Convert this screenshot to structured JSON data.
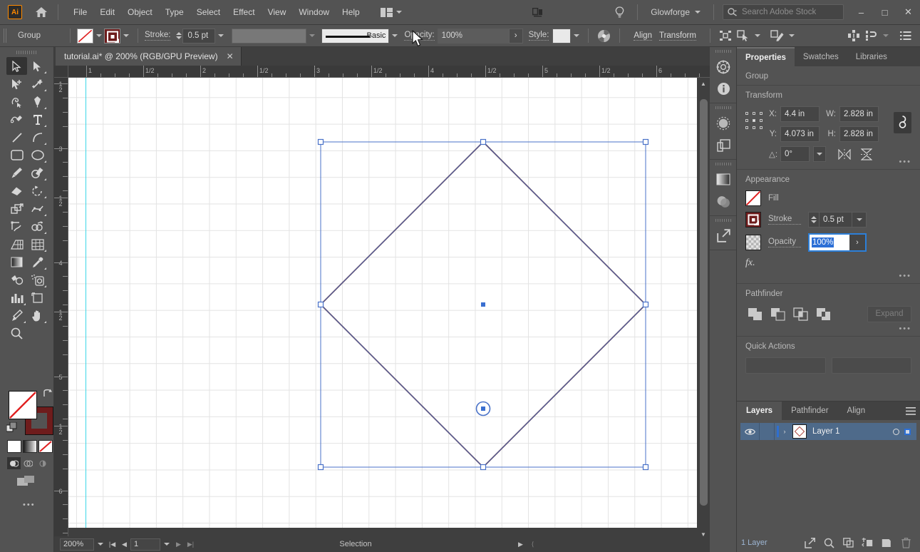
{
  "app": {
    "logo": "Ai",
    "home_icon": "home-icon",
    "arrange_icon": "arrange-documents-icon",
    "search_help_icon": "lightbulb-icon",
    "screen_share_icon": "share-screen-icon"
  },
  "menu": {
    "items": [
      "File",
      "Edit",
      "Object",
      "Type",
      "Select",
      "Effect",
      "View",
      "Window",
      "Help"
    ]
  },
  "account": {
    "workspace": "Glowforge",
    "chevron": "chevron-down-icon"
  },
  "search": {
    "placeholder": "Search Adobe Stock",
    "icon": "search-icon"
  },
  "window_controls": {
    "minimize": "–",
    "maximize": "□",
    "close": "✕"
  },
  "control_bar": {
    "selection_label": "Group",
    "fill_swatch": "none-swatch",
    "stroke_swatch": "stroke-swatch-maroon",
    "stroke_label": "Stroke:",
    "stroke_weight": "0.5 pt",
    "stroke_profile_placeholder": "",
    "brush_label": "Basic",
    "opacity_label": "Opacity:",
    "opacity_value": "100%",
    "style_label": "Style:",
    "recolor_icon": "recolor-artwork-icon",
    "align_label": "Align",
    "transform_label": "Transform",
    "shape_icon": "bounding-box-icon",
    "select_similar_icon": "select-similar-icon",
    "isolate_icon": "isolate-group-icon",
    "distribute_icon": "distribute-icon",
    "arrange_icon": "arrange-objects-icon",
    "options_icon": "panel-options-icon"
  },
  "document_tab": {
    "title": "tutorial.ai* @ 200% (RGB/GPU Preview)",
    "close": "✕"
  },
  "toolbar": {
    "tools": [
      {
        "name": "selection-tool",
        "glyph": "selection",
        "active": true
      },
      {
        "name": "direct-selection-tool",
        "glyph": "direct-selection",
        "active": false
      },
      {
        "name": "magic-wand-tool",
        "glyph": "group-selection",
        "active": false
      },
      {
        "name": "lasso-tool",
        "glyph": "magic-wand",
        "active": false
      },
      {
        "name": "curvature-tool",
        "glyph": "lasso",
        "active": false
      },
      {
        "name": "pen-tool",
        "glyph": "pen",
        "active": false
      },
      {
        "name": "add-anchor-point-tool",
        "glyph": "curvature",
        "active": false
      },
      {
        "name": "type-tool",
        "glyph": "type",
        "active": false
      },
      {
        "name": "line-segment-tool",
        "glyph": "line",
        "active": false
      },
      {
        "name": "arc-tool",
        "glyph": "arc",
        "active": false
      },
      {
        "name": "rectangle-tool",
        "glyph": "rectangle",
        "active": false
      },
      {
        "name": "ellipse-tool",
        "glyph": "ellipse",
        "active": false
      },
      {
        "name": "paintbrush-tool",
        "glyph": "paintbrush",
        "active": false
      },
      {
        "name": "shaper-tool",
        "glyph": "blob-brush",
        "active": false
      },
      {
        "name": "eraser-tool",
        "glyph": "eraser",
        "active": false
      },
      {
        "name": "rotate-tool",
        "glyph": "rotate",
        "active": false
      },
      {
        "name": "scale-tool",
        "glyph": "scale",
        "active": false
      },
      {
        "name": "width-tool",
        "glyph": "warp",
        "active": false
      },
      {
        "name": "free-transform-tool",
        "glyph": "puppet-warp",
        "active": false
      },
      {
        "name": "shape-builder-tool",
        "glyph": "shape-builder",
        "active": false
      },
      {
        "name": "perspective-grid-tool",
        "glyph": "perspective-grid",
        "active": false
      },
      {
        "name": "mesh-tool",
        "glyph": "mesh",
        "active": false
      },
      {
        "name": "gradient-tool",
        "glyph": "gradient",
        "active": false
      },
      {
        "name": "eyedropper-tool",
        "glyph": "eyedropper",
        "active": false
      },
      {
        "name": "blend-tool",
        "glyph": "blend",
        "active": false
      },
      {
        "name": "symbol-sprayer-tool",
        "glyph": "symbol-sprayer",
        "active": false
      },
      {
        "name": "column-graph-tool",
        "glyph": "column-graph",
        "active": false
      },
      {
        "name": "artboard-tool",
        "glyph": "artboard",
        "active": false
      },
      {
        "name": "slice-tool",
        "glyph": "slice",
        "active": false
      },
      {
        "name": "hand-tool",
        "glyph": "hand",
        "active": false
      },
      {
        "name": "zoom-tool",
        "glyph": "zoom",
        "active": false
      }
    ],
    "fill_swatch_name": "fill-none-swatch",
    "stroke_swatch_name": "stroke-maroon-swatch",
    "swap_icon": "swap-fill-stroke-icon",
    "default_icon": "default-fill-stroke-icon",
    "color_modes": [
      "color-swatch",
      "gradient-swatch",
      "none-swatch"
    ],
    "draw_modes": [
      "draw-normal",
      "draw-behind",
      "draw-inside"
    ],
    "screen_mode": "change-screen-mode-icon",
    "more_tools": "•••"
  },
  "canvas": {
    "h_ruler_labels": [
      "1",
      "1/2",
      "2",
      "1/2",
      "3",
      "1/2",
      "4",
      "1/2",
      "5",
      "1/2",
      "6"
    ],
    "v_ruler_labels": [
      "1/2",
      "3",
      "1/2",
      "4",
      "1/2",
      "5",
      "1/2",
      "6"
    ],
    "guide_color": "#3cd7e8",
    "shape": {
      "name": "diamond-path",
      "stroke_color": "#5a1d1d",
      "fill": "none"
    },
    "selection": {
      "bbox_color": "#2c6fd6",
      "handle_fill": "#ffffff",
      "anchor_widget": "live-corner-widget"
    }
  },
  "status_bar": {
    "zoom": "200%",
    "page": "1",
    "status_text": "Selection",
    "first_icon": "first-page-icon",
    "prev_icon": "prev-page-icon",
    "next_icon": "next-page-icon",
    "last_icon": "last-page-icon"
  },
  "icon_dock": {
    "icons": [
      {
        "name": "color-guide-icon"
      },
      {
        "name": "info-icon"
      },
      {
        "name": "appearance-icon"
      },
      {
        "name": "layers-dock-icon"
      },
      {
        "name": "gradient-dock-icon"
      },
      {
        "name": "transparency-icon"
      },
      {
        "name": "export-icon"
      }
    ]
  },
  "properties": {
    "tabs": [
      {
        "label": "Properties",
        "active": true
      },
      {
        "label": "Swatches",
        "active": false
      },
      {
        "label": "Libraries",
        "active": false
      }
    ],
    "selection_type": "Group",
    "transform": {
      "title": "Transform",
      "x_label": "X:",
      "x_value": "4.4 in",
      "y_label": "Y:",
      "y_value": "4.073 in",
      "w_label": "W:",
      "w_value": "2.828 in",
      "h_label": "H:",
      "h_value": "2.828 in",
      "angle_label": "△:",
      "angle_value": "0°",
      "link_icon": "constrain-proportions-icon",
      "flip_h_icon": "flip-horizontal-icon",
      "flip_v_icon": "flip-vertical-icon",
      "reference_point": "reference-point-selector",
      "more": "•••"
    },
    "appearance": {
      "title": "Appearance",
      "fill_label": "Fill",
      "stroke_label": "Stroke",
      "stroke_weight": "0.5 pt",
      "opacity_label": "Opacity",
      "opacity_value": "100%",
      "fx_label": "fx.",
      "more": "•••"
    },
    "pathfinder": {
      "title": "Pathfinder",
      "buttons": [
        "unite-icon",
        "minus-front-icon",
        "intersect-icon",
        "exclude-icon"
      ],
      "expand_label": "Expand",
      "more": "•••"
    },
    "quick_actions": {
      "title": "Quick Actions"
    }
  },
  "layers_panel": {
    "tabs": [
      {
        "label": "Layers",
        "active": true
      },
      {
        "label": "Pathfinder",
        "active": false
      },
      {
        "label": "Align",
        "active": false
      }
    ],
    "menu_icon": "panel-menu-icon",
    "layers": [
      {
        "name": "Layer 1",
        "visible": true,
        "expand": "›"
      }
    ],
    "footer_count": "1 Layer",
    "footer_icons": [
      "release-to-layers-icon",
      "locate-object-icon",
      "make-sublayer-icon",
      "create-new-sublayer-icon",
      "create-new-layer-icon",
      "delete-layer-icon"
    ]
  }
}
